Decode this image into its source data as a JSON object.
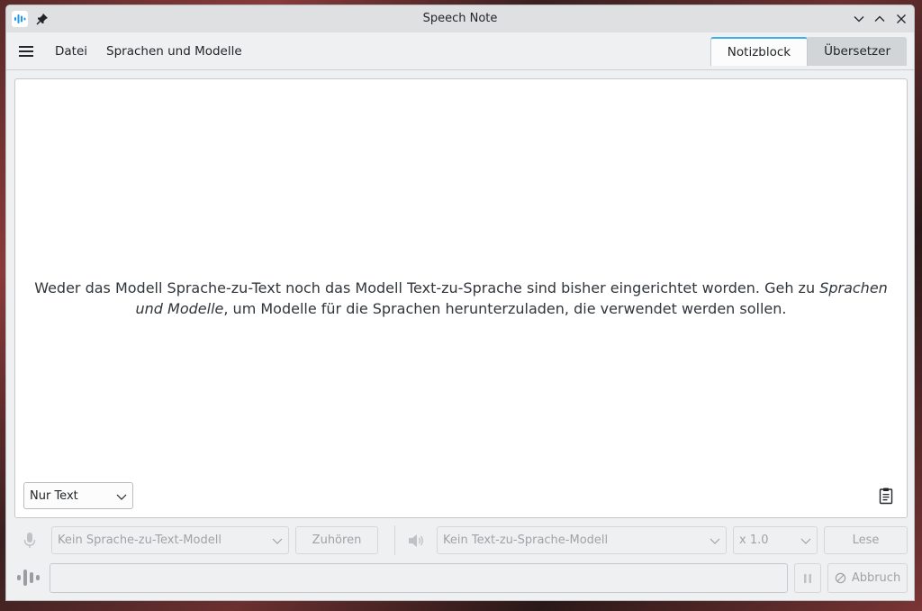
{
  "window": {
    "title": "Speech Note"
  },
  "menubar": {
    "file": "Datei",
    "languages": "Sprachen und Modelle"
  },
  "tabs": [
    {
      "label": "Notizblock",
      "active": true
    },
    {
      "label": "Übersetzer",
      "active": false
    }
  ],
  "editor": {
    "message_before": "Weder das Modell Sprache-zu-Text noch das Modell Text-zu-Sprache sind bisher eingerichtet worden. Geh zu ",
    "message_link": "Sprachen und Modelle",
    "message_after": ", um Modelle für die Sprachen herunterzuladen, die verwendet werden sollen.",
    "mode_select": "Nur Text"
  },
  "controls": {
    "stt_model": "Kein Sprache-zu-Text-Modell",
    "listen_label": "Zuhören",
    "tts_model": "Kein Text-zu-Sprache-Modell",
    "speed": "x 1.0",
    "read_label": "Lese",
    "cancel_label": "Abbruch"
  },
  "colors": {
    "accent": "#3daee9",
    "window_bg": "#eff0f1",
    "disabled_text": "#a0a3a6"
  },
  "icons": {
    "app": "speech-note-app-icon",
    "pin": "pin-icon",
    "minimize": "chevron-down-icon",
    "maximize": "chevron-up-icon",
    "close": "close-icon",
    "menu": "hamburger-menu-icon",
    "clipboard": "clipboard-icon",
    "microphone": "microphone-icon",
    "speaker": "speaker-icon",
    "waveform": "waveform-icon",
    "pause": "pause-icon",
    "cancel": "cancel-icon"
  }
}
